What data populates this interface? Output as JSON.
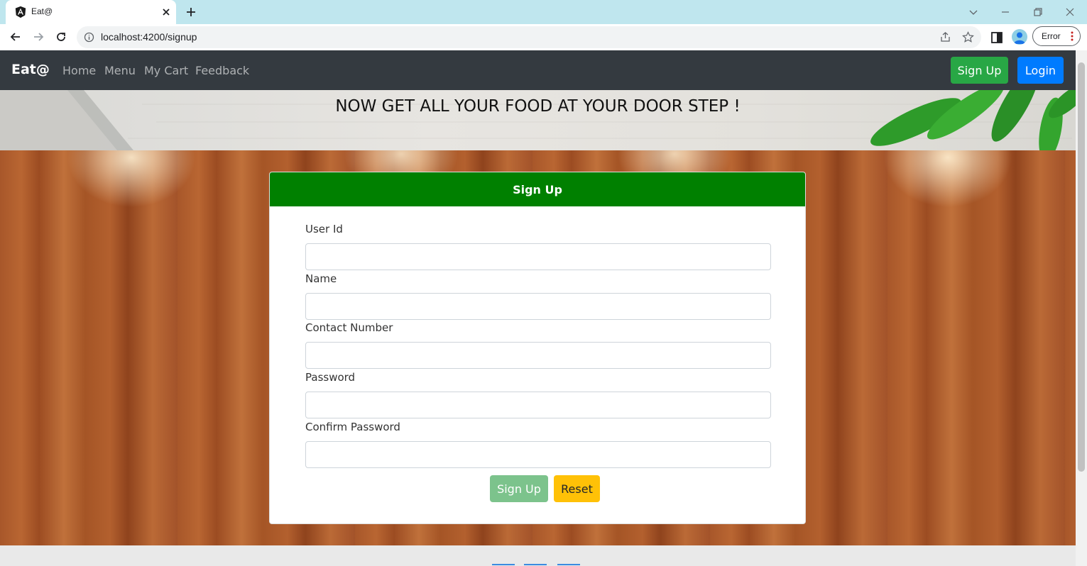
{
  "browser": {
    "tab_title": "Eat@",
    "url": "localhost:4200/signup",
    "profile_status": "Error"
  },
  "navbar": {
    "brand": "Eat@",
    "links": [
      "Home",
      "Menu",
      "My Cart",
      "Feedback"
    ],
    "signup_label": "Sign Up",
    "login_label": "Login"
  },
  "banner": {
    "text": "NOW GET ALL YOUR FOOD AT YOUR DOOR STEP !"
  },
  "form": {
    "title": "Sign Up",
    "fields": [
      {
        "label": "User Id",
        "value": ""
      },
      {
        "label": "Name",
        "value": ""
      },
      {
        "label": "Contact Number",
        "value": ""
      },
      {
        "label": "Password",
        "value": ""
      },
      {
        "label": "Confirm Password",
        "value": ""
      }
    ],
    "submit_label": "Sign Up",
    "reset_label": "Reset"
  },
  "colors": {
    "navbar": "#343a40",
    "success": "#28a745",
    "primary": "#007bff",
    "card_header": "#008000",
    "warning": "#ffc107"
  },
  "icons": [
    "angular-favicon-icon",
    "close-icon",
    "plus-icon",
    "back-arrow-icon",
    "forward-arrow-icon",
    "reload-icon",
    "info-icon",
    "share-icon",
    "star-icon",
    "side-panel-icon",
    "profile-icon",
    "kebab-menu-icon"
  ]
}
